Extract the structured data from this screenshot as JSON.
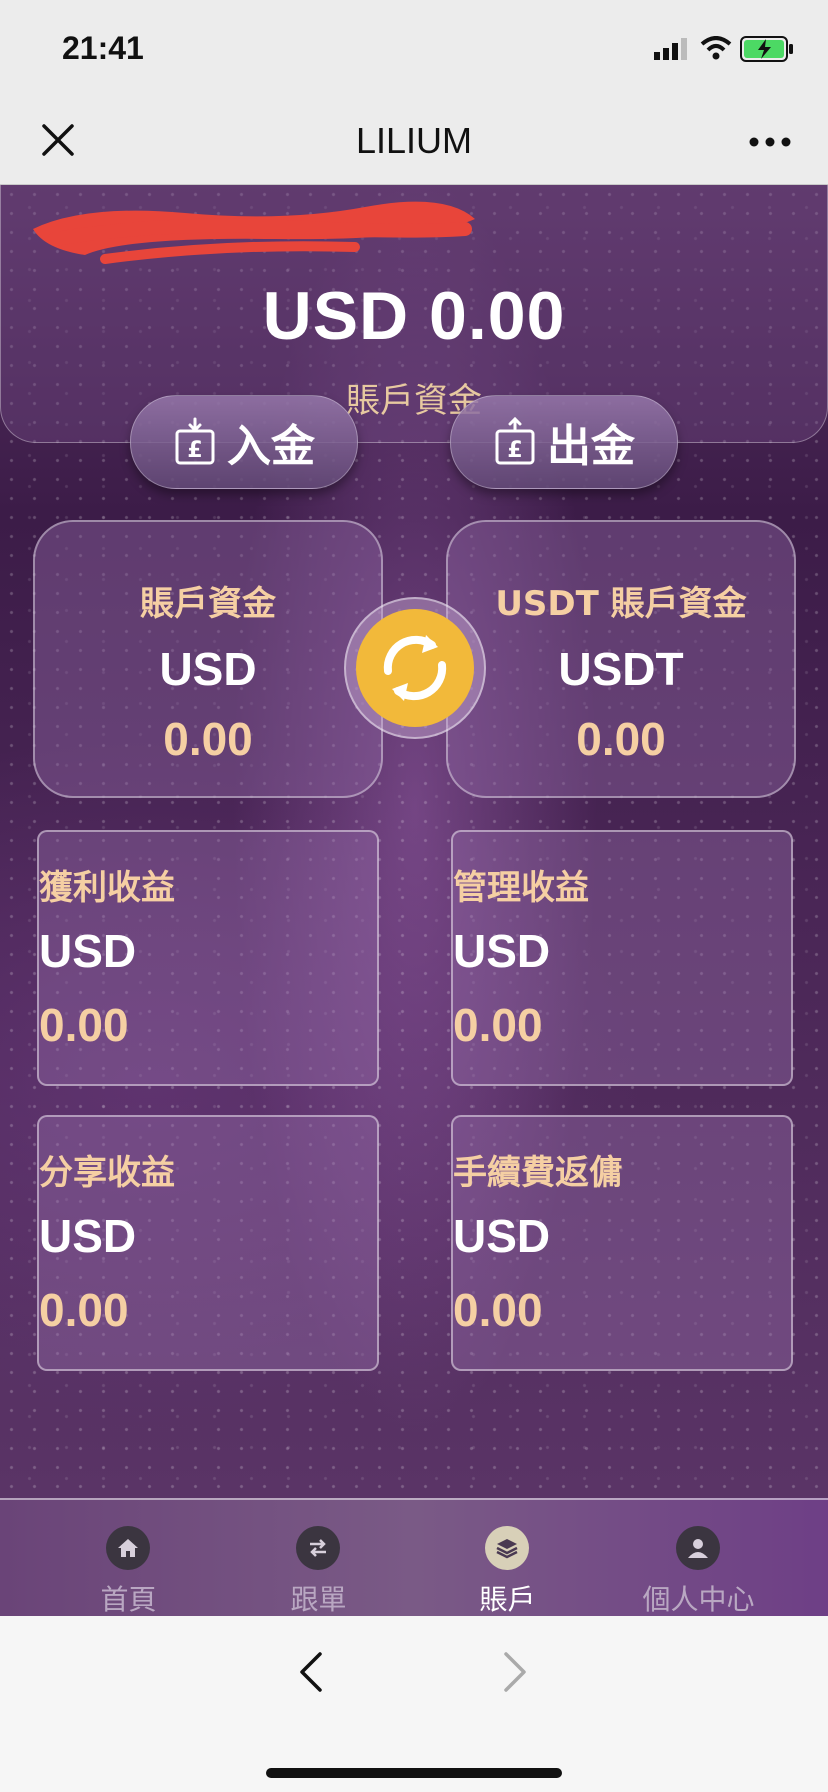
{
  "status_bar": {
    "time": "21:41"
  },
  "nav": {
    "title": "LILIUM"
  },
  "balance": {
    "amount": "USD 0.00",
    "label": "賬戶資金"
  },
  "actions": {
    "deposit_label": "入金",
    "withdraw_label": "出金"
  },
  "wallets": [
    {
      "title": "賬戶資金",
      "currency": "USD",
      "value": "0.00"
    },
    {
      "title": "USDT 賬戶資金",
      "currency": "USDT",
      "value": "0.00"
    }
  ],
  "earnings": [
    {
      "title": "獲利收益",
      "currency": "USD",
      "value": "0.00"
    },
    {
      "title": "管理收益",
      "currency": "USD",
      "value": "0.00"
    },
    {
      "title": "分享收益",
      "currency": "USD",
      "value": "0.00"
    },
    {
      "title": "手續費返傭",
      "currency": "USD",
      "value": "0.00"
    }
  ],
  "tabs": [
    {
      "label": "首頁",
      "icon": "home-icon",
      "active": false
    },
    {
      "label": "跟單",
      "icon": "swap-arrows-icon",
      "active": false
    },
    {
      "label": "賬戶",
      "icon": "layers-icon",
      "active": true
    },
    {
      "label": "個人中心",
      "icon": "person-icon",
      "active": false
    }
  ],
  "colors": {
    "accent_gold": "#f5cfa3",
    "swap_yellow": "#f2b93a",
    "tab_active": "#ffffff",
    "tab_inactive": "#b9a7c2"
  }
}
